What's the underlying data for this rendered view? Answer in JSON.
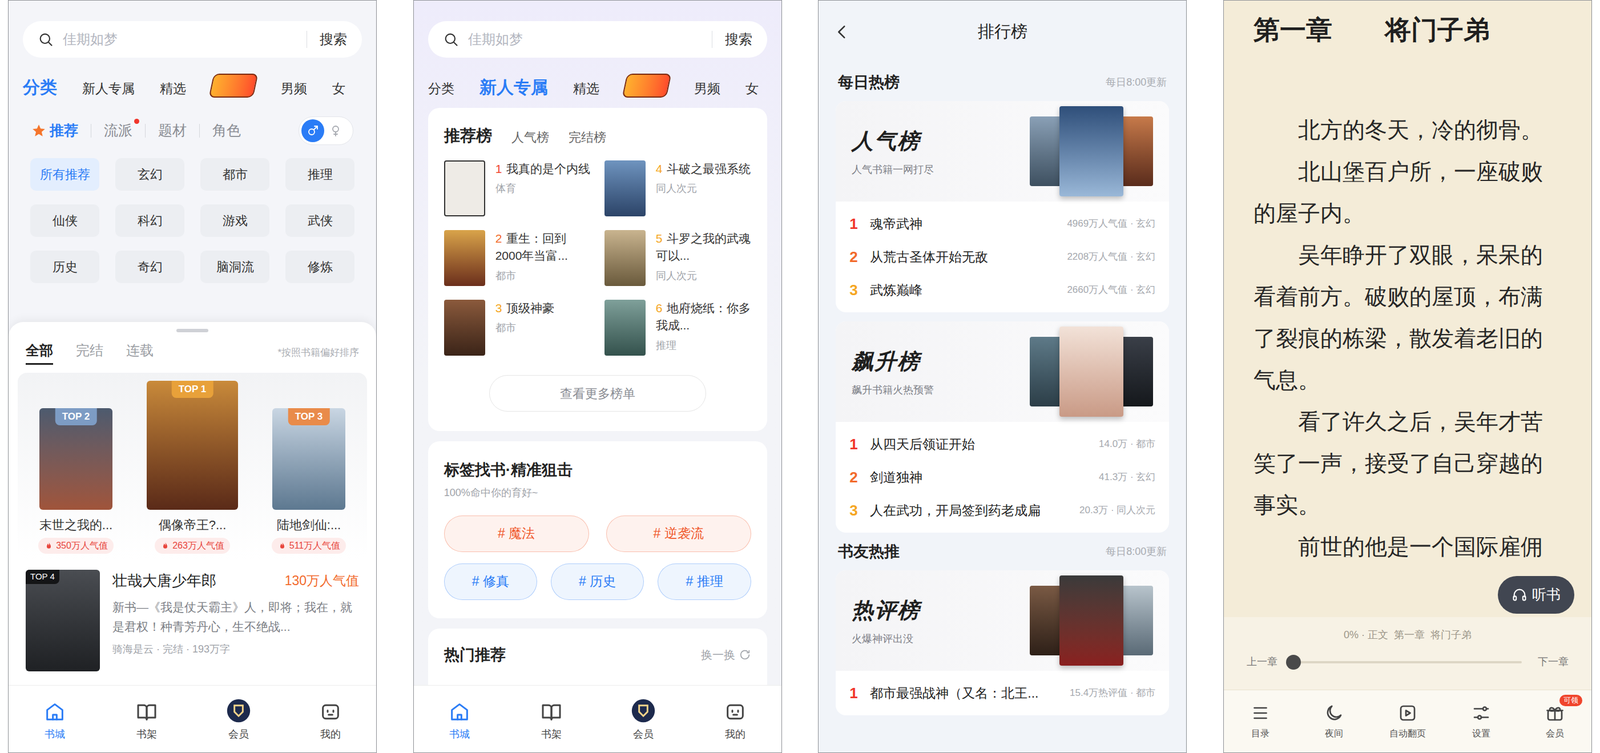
{
  "category_screen": {
    "search": {
      "placeholder": "佳期如梦",
      "button": "搜索"
    },
    "top_tabs": [
      {
        "kind": "text",
        "label": "分类",
        "selected": true
      },
      {
        "kind": "text",
        "label": "新人专属",
        "selected": false
      },
      {
        "kind": "text",
        "label": "精选",
        "selected": false
      },
      {
        "kind": "logo",
        "selected": false
      },
      {
        "kind": "text",
        "label": "男频",
        "selected": false
      },
      {
        "kind": "text",
        "label": "女",
        "selected": false
      }
    ],
    "filter_tabs": [
      {
        "label": "推荐",
        "selected": true,
        "dot": false
      },
      {
        "label": "流派",
        "selected": false,
        "dot": true
      },
      {
        "label": "题材",
        "selected": false,
        "dot": false
      },
      {
        "label": "角色",
        "selected": false,
        "dot": false
      }
    ],
    "gender_toggle": {
      "male_selected": true
    },
    "genres": [
      {
        "label": "所有推荐",
        "selected": true
      },
      {
        "label": "玄幻",
        "selected": false
      },
      {
        "label": "都市",
        "selected": false
      },
      {
        "label": "推理",
        "selected": false
      },
      {
        "label": "仙侠",
        "selected": false
      },
      {
        "label": "科幻",
        "selected": false
      },
      {
        "label": "游戏",
        "selected": false
      },
      {
        "label": "武侠",
        "selected": false
      },
      {
        "label": "历史",
        "selected": false
      },
      {
        "label": "奇幻",
        "selected": false
      },
      {
        "label": "脑洞流",
        "selected": false
      },
      {
        "label": "修炼",
        "selected": false
      }
    ],
    "sheet": {
      "tabs": [
        {
          "label": "全部",
          "selected": true
        },
        {
          "label": "完结",
          "selected": false
        },
        {
          "label": "连载",
          "selected": false
        }
      ],
      "hint": "*按照书籍偏好排序",
      "podium": [
        {
          "rank": "TOP 2",
          "title": "末世之我的...",
          "heat": "350万人气值"
        },
        {
          "rank": "TOP 1",
          "title": "偶像帝王?...",
          "heat": "263万人气值"
        },
        {
          "rank": "TOP 3",
          "title": "陆地剑仙:...",
          "heat": "511万人气值"
        }
      ],
      "featured": {
        "rank": "TOP 4",
        "title": "壮哉大唐少年郎",
        "heat": "130万人气值",
        "desc": "新书—《我是仗天霸主》人，即将；我在，就是君权！种青芳丹心，生不绝战...",
        "meta": "骑海是云 · 完结 · 193万字"
      }
    },
    "nav": [
      {
        "label": "书城",
        "selected": true
      },
      {
        "label": "书架",
        "selected": false
      },
      {
        "label": "会员",
        "selected": false
      },
      {
        "label": "我的",
        "selected": false
      }
    ]
  },
  "newbie_screen": {
    "search": {
      "placeholder": "佳期如梦",
      "button": "搜索"
    },
    "top_tabs": [
      {
        "kind": "text",
        "label": "分类",
        "selected": false
      },
      {
        "kind": "text",
        "label": "新人专属",
        "selected": true
      },
      {
        "kind": "text",
        "label": "精选",
        "selected": false
      },
      {
        "kind": "logo",
        "selected": false
      },
      {
        "kind": "text",
        "label": "男频",
        "selected": false
      },
      {
        "kind": "text",
        "label": "女",
        "selected": false
      }
    ],
    "rank_card": {
      "tabs": [
        {
          "label": "推荐榜",
          "selected": true
        },
        {
          "label": "人气榜",
          "selected": false
        },
        {
          "label": "完结榜",
          "selected": false
        }
      ],
      "books": [
        {
          "rank": "1",
          "title": "我真的是个内线",
          "category": "体育"
        },
        {
          "rank": "2",
          "title": "重生：回到2000年当富...",
          "category": "都市"
        },
        {
          "rank": "3",
          "title": "顶级神豪",
          "category": "都市"
        },
        {
          "rank": "4",
          "title": "斗破之最强系统",
          "category": "同人次元"
        },
        {
          "rank": "5",
          "title": "斗罗之我的武魂可以...",
          "category": "同人次元"
        },
        {
          "rank": "6",
          "title": "地府烧纸：你多我成...",
          "category": "推理"
        }
      ],
      "more_button": "查看更多榜单"
    },
    "tag_card": {
      "title": "标签找书·精准狙击",
      "subtitle": "100%命中你的育好~",
      "tags": [
        {
          "label": "# 魔法",
          "color": "#f0572a"
        },
        {
          "label": "# 逆袭流",
          "color": "#f0572a"
        },
        {
          "label": "# 修真",
          "color": "#2a7cf6"
        },
        {
          "label": "# 历史",
          "color": "#2a7cf6"
        },
        {
          "label": "# 推理",
          "color": "#2a7cf6"
        }
      ]
    },
    "hot_card": {
      "title": "热门推荐",
      "refresh": "换一换"
    },
    "nav": [
      {
        "label": "书城",
        "selected": true
      },
      {
        "label": "书架",
        "selected": false
      },
      {
        "label": "会员",
        "selected": false
      },
      {
        "label": "我的",
        "selected": false
      }
    ]
  },
  "ranking_screen": {
    "header": {
      "title": "排行榜"
    },
    "sections": [
      {
        "title": "每日热榜",
        "note": "每日8:00更新",
        "boards": [
          {
            "name": "人气榜",
            "subtitle": "人气书籍一网打尽",
            "items": [
              {
                "rank": "1",
                "title": "魂帝武神",
                "meta": "4969万人气值 · 玄幻"
              },
              {
                "rank": "2",
                "title": "从荒古圣体开始无敌",
                "meta": "2208万人气值 · 玄幻"
              },
              {
                "rank": "3",
                "title": "武炼巅峰",
                "meta": "2660万人气值 · 玄幻"
              }
            ]
          },
          {
            "name": "飙升榜",
            "subtitle": "飙升书籍火热预警",
            "items": [
              {
                "rank": "1",
                "title": "从四天后领证开始",
                "meta": "14.0万 · 都市"
              },
              {
                "rank": "2",
                "title": "剑道独神",
                "meta": "41.3万 · 玄幻"
              },
              {
                "rank": "3",
                "title": "人在武功，开局签到药老成扁",
                "meta": "20.3万 · 同人次元"
              }
            ]
          }
        ]
      },
      {
        "title": "书友热推",
        "note": "每日8:00更新",
        "boards": [
          {
            "name": "热评榜",
            "subtitle": "火爆神评出没",
            "items": [
              {
                "rank": "1",
                "title": "都市最强战神（又名：北王...",
                "meta": "15.4万热评值 · 都市"
              }
            ]
          }
        ]
      }
    ]
  },
  "reader_screen": {
    "chapter_title": "第一章　　将门子弟",
    "paragraphs": [
      "北方的冬天，冷的彻骨。",
      "北山堡百户所，一座破败的屋子内。",
      "吴年睁开了双眼，呆呆的看着前方。破败的屋顶，布满了裂痕的栋梁，散发着老旧的气息。",
      "看了许久之后，吴年才苦笑了一声，接受了自己穿越的事实。",
      "前世的他是一个国际雇佣"
    ],
    "listen_button": "听书",
    "progress": "0% · 正文  第一章  将门子弟",
    "prev": "上一章",
    "next": "下一章",
    "slider": {
      "level": 0
    },
    "toolbar": [
      {
        "label": "目录"
      },
      {
        "label": "夜间"
      },
      {
        "label": "自动翻页"
      },
      {
        "label": "设置"
      },
      {
        "label": "会员",
        "badge": "可领"
      }
    ]
  }
}
